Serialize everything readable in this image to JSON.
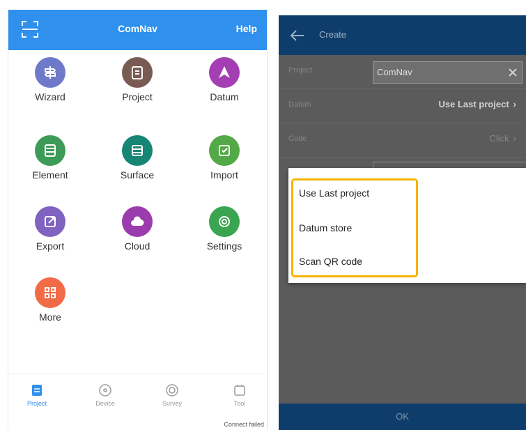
{
  "left": {
    "title": "ComNav",
    "help": "Help",
    "tiles": [
      {
        "label": "Wizard",
        "icon": "wizard-icon",
        "color": "#6f79c9"
      },
      {
        "label": "Project",
        "icon": "project-icon",
        "color": "#7a5b53"
      },
      {
        "label": "Datum",
        "icon": "datum-icon",
        "color": "#a33fb3"
      },
      {
        "label": "Element",
        "icon": "element-icon",
        "color": "#3e9b57"
      },
      {
        "label": "Surface",
        "icon": "surface-icon",
        "color": "#178574"
      },
      {
        "label": "Import",
        "icon": "import-icon",
        "color": "#53a947"
      },
      {
        "label": "Export",
        "icon": "export-icon",
        "color": "#8062c0"
      },
      {
        "label": "Cloud",
        "icon": "cloud-icon",
        "color": "#9b3cae"
      },
      {
        "label": "Settings",
        "icon": "settings-icon",
        "color": "#3aa550"
      },
      {
        "label": "More",
        "icon": "more-icon",
        "color": "#f26b47"
      }
    ],
    "nav": [
      {
        "label": "Project",
        "icon": "project-nav-icon"
      },
      {
        "label": "Device",
        "icon": "device-nav-icon"
      },
      {
        "label": "Survey",
        "icon": "survey-nav-icon"
      },
      {
        "label": "Tool",
        "icon": "tool-nav-icon"
      }
    ],
    "connect_status": "Connect failed"
  },
  "right": {
    "title": "Create",
    "rows": {
      "project_label": "Project",
      "project_value": "ComNav",
      "datum_label": "Datum",
      "datum_value": "Use Last project",
      "code_label": "Code",
      "code_value": "Click"
    },
    "dropdown": [
      "Use Last project",
      "Datum store",
      "Scan QR code"
    ],
    "ok": "OK"
  },
  "colors": {
    "primary": "#2f90ee",
    "dark_header": "#0f3d6b",
    "highlight": "#f6b300"
  }
}
